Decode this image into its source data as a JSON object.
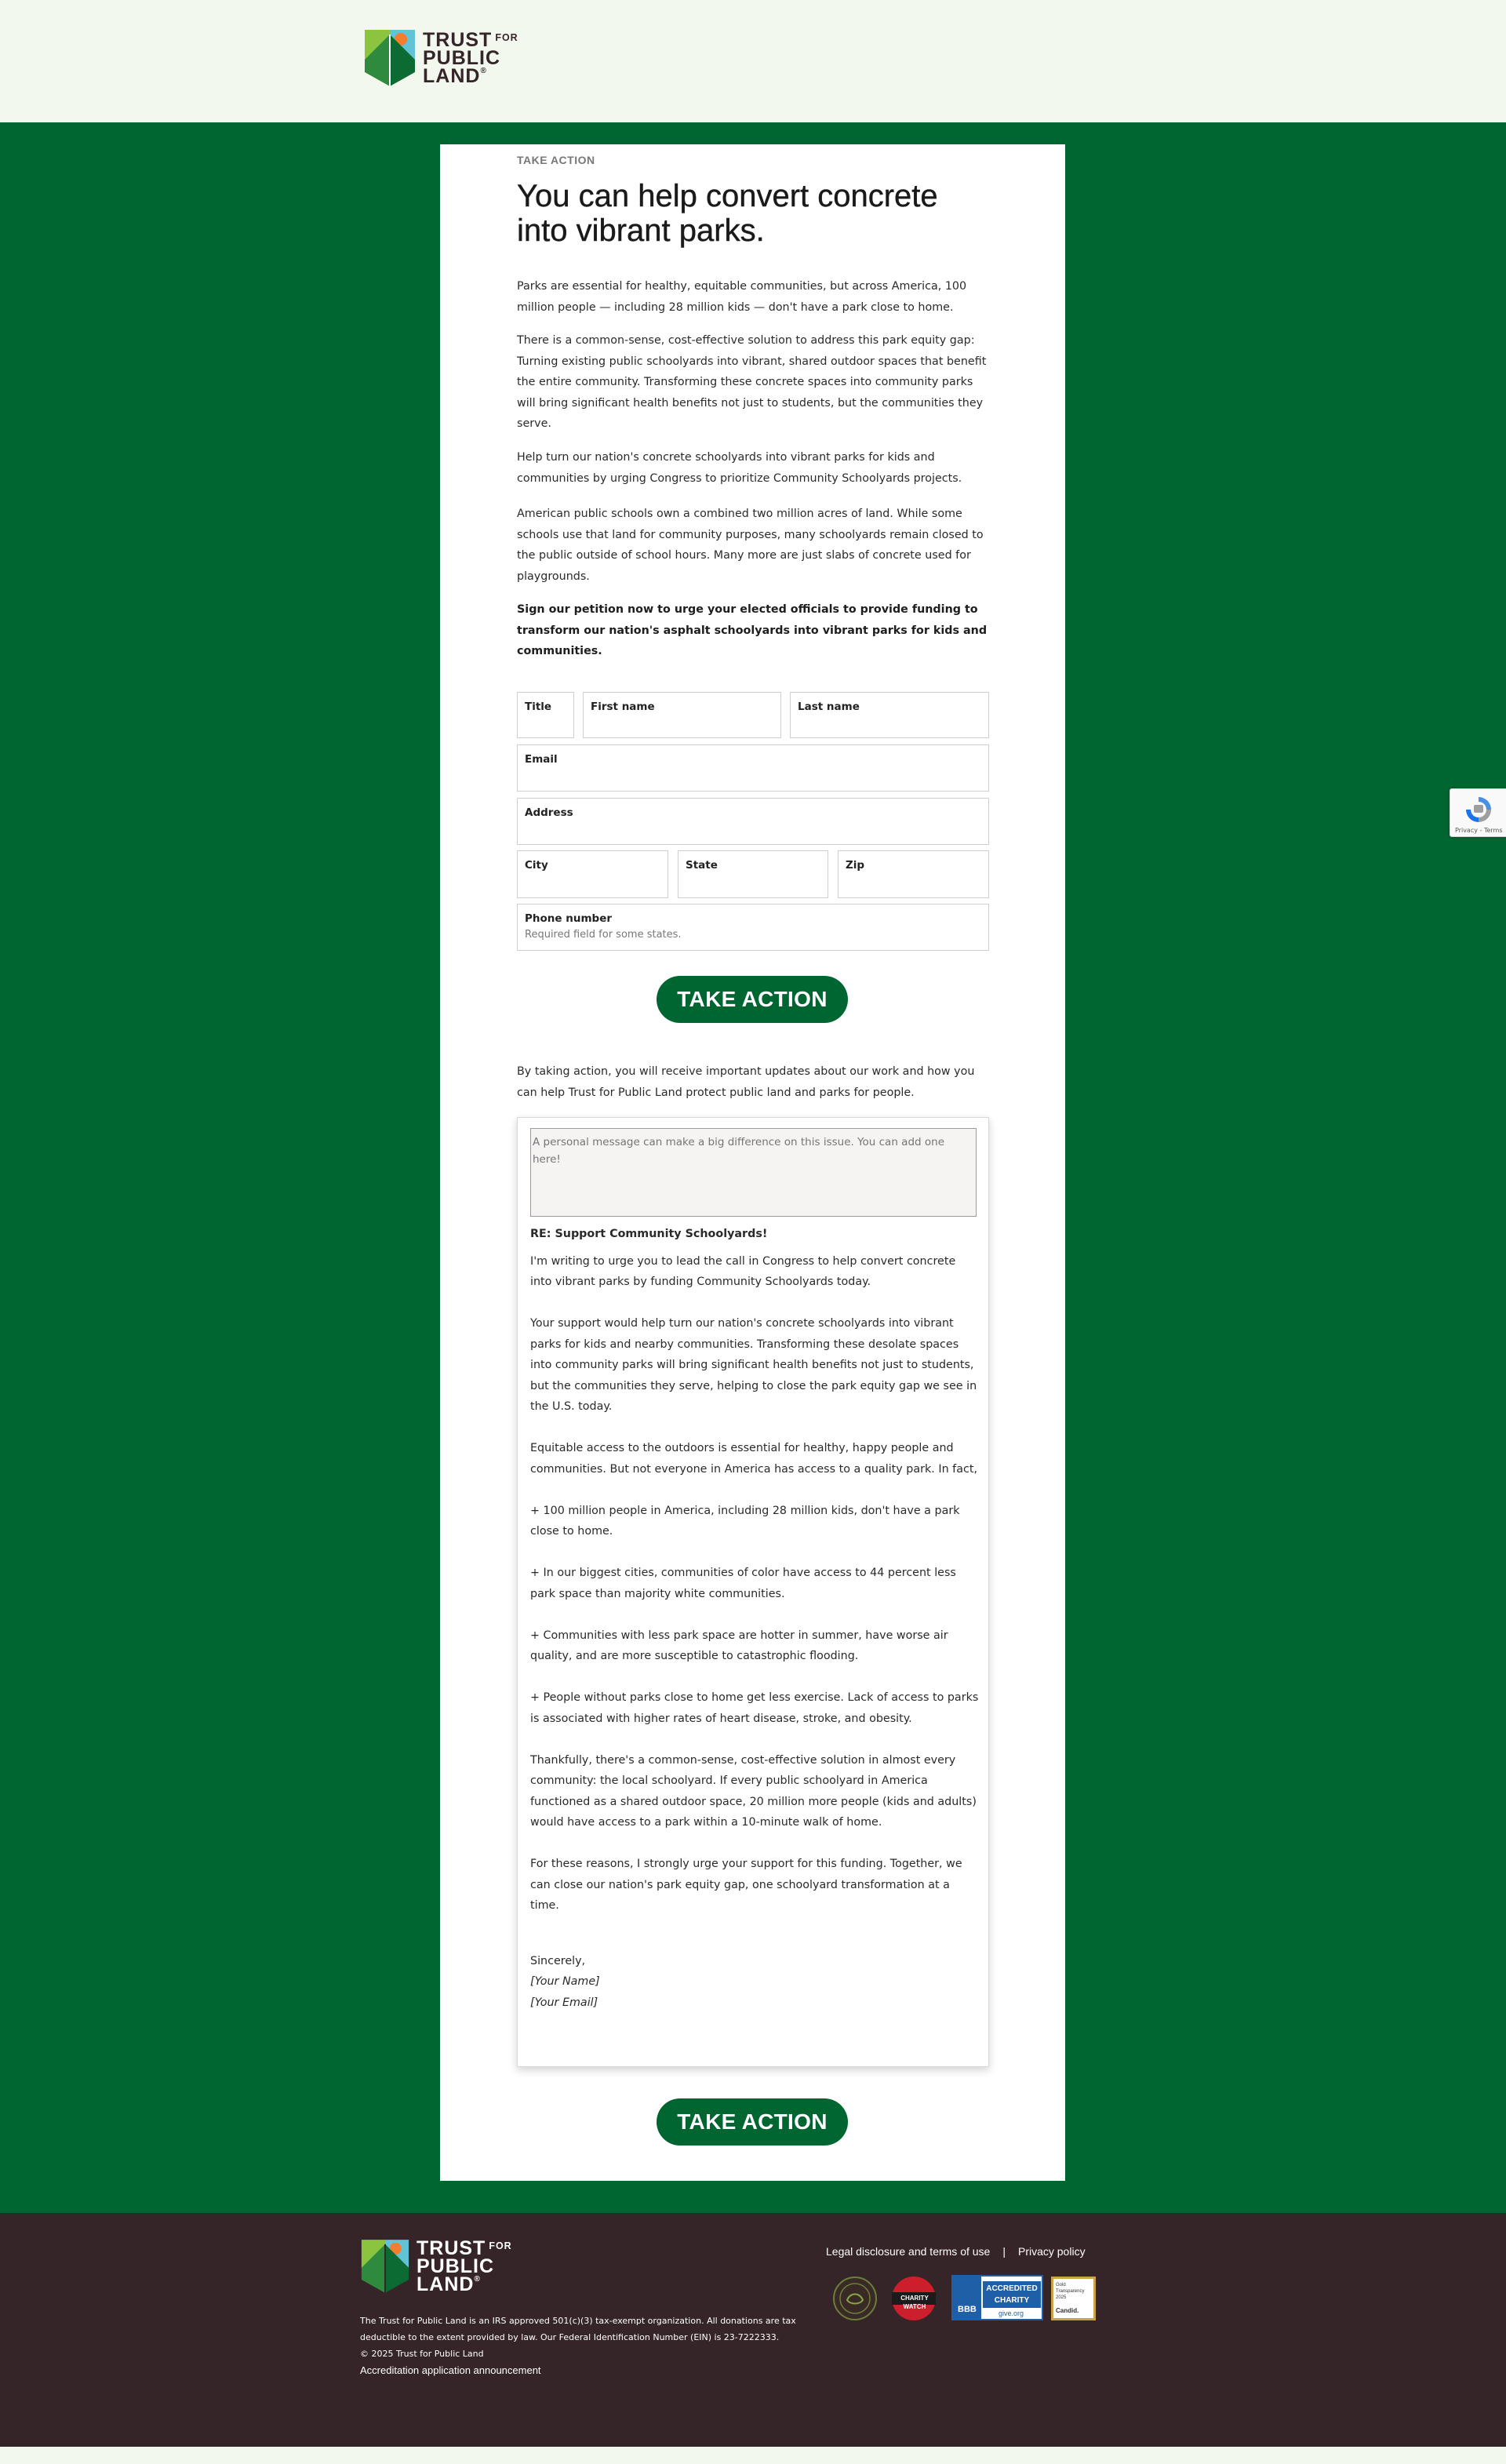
{
  "brand": {
    "line1": "TRUST",
    "for": "FOR",
    "line2": "PUBLIC",
    "line3": "LAND",
    "reg": "®"
  },
  "main": {
    "eyebrow": "TAKE ACTION",
    "headline": "You can help convert concrete into vibrant parks.",
    "paragraphs": [
      "Parks are essential for healthy, equitable communities, but across America, 100 million people — including 28 million kids — don't have a park close to home.",
      "There is a common-sense, cost-effective solution to address this park equity gap: Turning existing public schoolyards into vibrant, shared outdoor spaces that benefit the entire community. Transforming these concrete spaces into community parks will bring significant health benefits not just to students, but the communities they serve.",
      "Help turn our nation's concrete schoolyards into vibrant parks for kids and communities by urging Congress to prioritize Community Schoolyards projects.",
      "American public schools own a combined two million acres of land. While some schools use that land for community purposes, many schoolyards remain closed to the public outside of school hours. Many more are just slabs of concrete used for playgrounds."
    ],
    "cta_text": "Sign our petition now to urge your elected officials to provide funding to transform our nation's asphalt schoolyards into vibrant parks for kids and communities."
  },
  "form": {
    "title_label": "Title",
    "first_name_label": "First name",
    "last_name_label": "Last name",
    "email_label": "Email",
    "address_label": "Address",
    "city_label": "City",
    "state_label": "State",
    "zip_label": "Zip",
    "phone_label": "Phone number",
    "phone_hint": "Required field for some states.",
    "submit_label": "TAKE ACTION"
  },
  "consent_text": "By taking action, you will receive important updates about our work and how you can help Trust for Public Land protect public land and parks for people.",
  "letter": {
    "placeholder": "A personal message can make a big difference on this issue. You can add one here!",
    "subject": "RE: Support Community Schoolyards!",
    "paragraphs": [
      "I'm writing to urge you to lead the call in Congress to help convert concrete into vibrant parks by funding Community Schoolyards today.",
      "Your support would help turn our nation's concrete schoolyards into vibrant parks for kids and nearby communities. Transforming these desolate spaces into community parks will bring significant health benefits not just to students, but the communities they serve, helping to close the park equity gap we see in the U.S. today.",
      "Equitable access to the outdoors is essential for healthy, happy people and communities. But not everyone in America has access to a quality park. In fact,",
      "+ 100 million people in America, including 28 million kids, don't have a park close to home.",
      "+ In our biggest cities, communities of color have access to 44 percent less park space than majority white communities.",
      "+ Communities with less park space are hotter in summer, have worse air quality, and are more susceptible to catastrophic flooding.",
      "+ People without parks close to home get less exercise. Lack of access to parks is associated with higher rates of heart disease, stroke, and obesity.",
      "Thankfully, there's a common-sense, cost-effective solution in almost every community: the local schoolyard. If every public schoolyard in America functioned as a shared outdoor space, 20 million more people (kids and adults) would have access to a park within a 10-minute walk of home.",
      "For these reasons, I strongly urge your support for this funding. Together, we can close our nation's park equity gap, one schoolyard transformation at a time."
    ],
    "closing": "Sincerely,",
    "name_token": "[Your Name]",
    "email_token": "[Your Email]",
    "submit_label": "TAKE ACTION"
  },
  "recaptcha": {
    "text": "Privacy - Terms"
  },
  "footer": {
    "legal_link": "Legal disclosure and terms of use",
    "separator": "|",
    "privacy_link": "Privacy policy",
    "disclaimer_line1": "The Trust for Public Land is an IRS approved 501(c)(3) tax-exempt organization. All donations are tax",
    "disclaimer_line2": "deductible to the extent provided by law. Our Federal Identification Number (EIN) is 23-7222333.",
    "copyright": "© 2025 Trust for Public Land",
    "accreditation_link": "Accreditation application announcement",
    "badges": {
      "charity_watch": "CHARITY WATCH",
      "bbb_line1": "ACCREDITED",
      "bbb_line2": "CHARITY",
      "bbb_brand": "BBB",
      "bbb_site": "give.org",
      "candid_line1": "Gold",
      "candid_line2": "Transparency",
      "candid_line3": "2025",
      "candid_brand": "Candid."
    }
  },
  "colors": {
    "brand_green": "#006631",
    "header_bg": "#f3f8ee",
    "footer_bg": "#352428"
  }
}
